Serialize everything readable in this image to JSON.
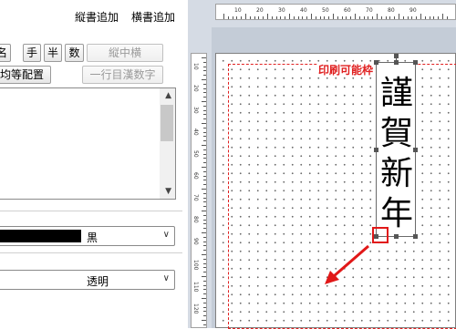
{
  "toolbar": {
    "vertical_add": "縦書追加",
    "horizontal_add": "横書追加"
  },
  "buttons": {
    "name": "名",
    "te": "手",
    "han": "半",
    "suu": "数",
    "tatechuyoko": "縦中横",
    "kinto": "均等配置",
    "ichigyo": "一行目漢数字"
  },
  "color_select": {
    "value": "黒",
    "swatch": "#000000"
  },
  "transparency_select": {
    "value": "透明"
  },
  "ruler_top": {
    "labels": [
      "10",
      "20",
      "30",
      "40",
      "50",
      "60",
      "70",
      "80",
      "90"
    ]
  },
  "ruler_left": {
    "labels": [
      "10",
      "20",
      "30",
      "40",
      "50",
      "60",
      "70",
      "80",
      "90",
      "100",
      "110",
      "120"
    ]
  },
  "canvas": {
    "print_area_label": "印刷可能枠",
    "text": "謹賀新年",
    "accent": "#e02020"
  }
}
